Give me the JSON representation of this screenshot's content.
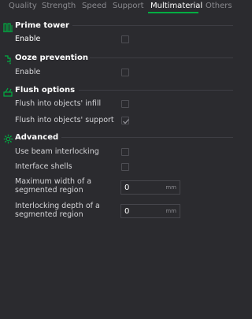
{
  "tabs": [
    "Quality",
    "Strength",
    "Speed",
    "Support",
    "Multimaterial",
    "Others"
  ],
  "active_tab": "Multimaterial",
  "prime_tower": {
    "title": "Prime tower",
    "enable_label": "Enable",
    "enable_checked": false
  },
  "ooze_prevention": {
    "title": "Ooze prevention",
    "enable_label": "Enable",
    "enable_checked": false
  },
  "flush_options": {
    "title": "Flush options",
    "infill_label": "Flush into objects' infill",
    "infill_checked": false,
    "support_label": "Flush into objects' support",
    "support_checked": true
  },
  "advanced": {
    "title": "Advanced",
    "beam_label": "Use beam interlocking",
    "beam_checked": false,
    "shells_label": "Interface shells",
    "shells_checked": false,
    "max_width_label_1": "Maximum width of a",
    "max_width_label_2": "segmented region",
    "max_width_value": "0",
    "max_width_unit": "mm",
    "depth_label_1": "Interlocking depth of a",
    "depth_label_2": "segmented region",
    "depth_value": "0",
    "depth_unit": "mm"
  },
  "colors": {
    "accent": "#00ae42",
    "background": "#2b2b2f"
  }
}
